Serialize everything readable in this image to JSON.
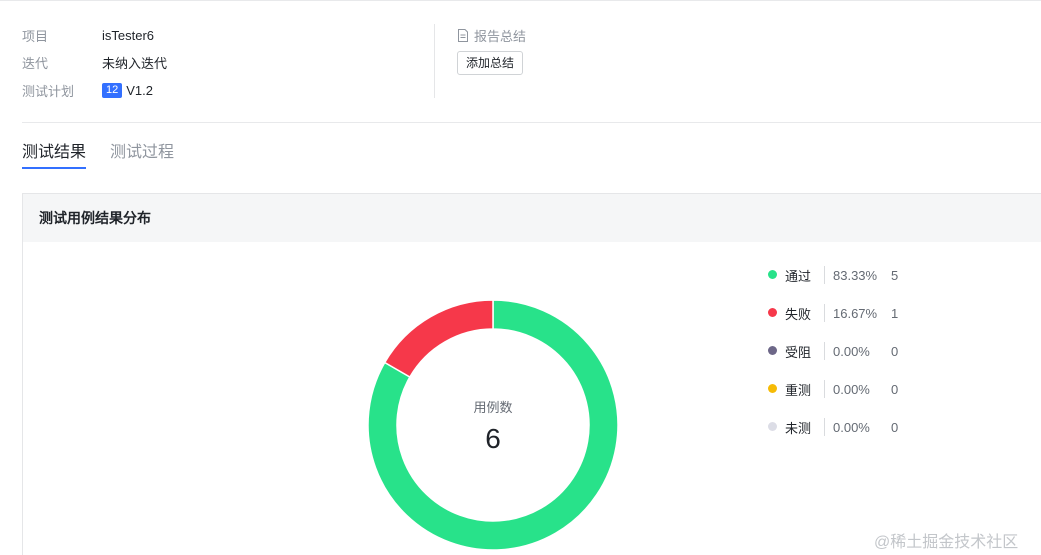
{
  "info": {
    "project_label": "项目",
    "project_value": "isTester6",
    "iteration_label": "迭代",
    "iteration_value": "未纳入迭代",
    "plan_label": "测试计划",
    "plan_badge": "12",
    "plan_value": "V1.2"
  },
  "summary": {
    "title": "报告总结",
    "add_button": "添加总结"
  },
  "tabs": [
    {
      "label": "测试结果",
      "active": true
    },
    {
      "label": "测试过程",
      "active": false
    }
  ],
  "panel": {
    "title": "测试用例结果分布"
  },
  "chart_data": {
    "type": "pie",
    "center_label": "用例数",
    "total": "6",
    "series": [
      {
        "name": "通过",
        "percent": "83.33%",
        "count": 5,
        "color": "#28e28a"
      },
      {
        "name": "失败",
        "percent": "16.67%",
        "count": 1,
        "color": "#f6384a"
      },
      {
        "name": "受阻",
        "percent": "0.00%",
        "count": 0,
        "color": "#6d6788"
      },
      {
        "name": "重测",
        "percent": "0.00%",
        "count": 0,
        "color": "#f6bb06"
      },
      {
        "name": "未测",
        "percent": "0.00%",
        "count": 0,
        "color": "#dcdde6"
      }
    ]
  },
  "watermark": "@稀土掘金技术社区"
}
